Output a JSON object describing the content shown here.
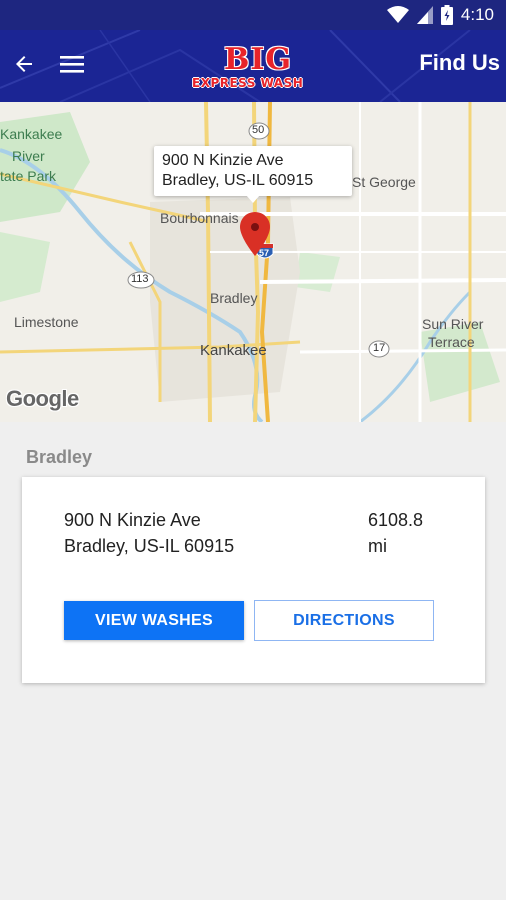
{
  "status_bar": {
    "time": "4:10",
    "icons": [
      "wifi-icon",
      "cell-signal-icon",
      "battery-icon"
    ]
  },
  "app_bar": {
    "title": "Find Us",
    "back_icon": "arrow-back-icon",
    "menu_icon": "hamburger-menu-icon",
    "logo": {
      "big": "BIG",
      "sub": "EXPRESS WASH"
    },
    "colors": {
      "background": "#1b2594",
      "status_bar": "#1e2680"
    }
  },
  "map": {
    "callout": {
      "line1": "900 N Kinzie Ave",
      "line2": "Bradley, US-IL  60915"
    },
    "labels": {
      "kankakee_river": "Kankakee",
      "river": "River",
      "state_park": "tate Park",
      "bourbonnais": "Bourbonnais",
      "st_george": "St George",
      "bradley": "Bradley",
      "limestone": "Limestone",
      "kankakee": "Kankakee",
      "sun_river": "Sun River",
      "terrace": "Terrace"
    },
    "shields": {
      "route_50": "50",
      "route_113": "113",
      "route_17": "17",
      "interstate_57": "57"
    },
    "attribution": "Google",
    "pin_icon": "map-pin-icon"
  },
  "section": {
    "title": "Bradley"
  },
  "location_card": {
    "address_line1": "900 N Kinzie Ave",
    "address_line2": "Bradley, US-IL  60915",
    "distance_value": "6108.8",
    "distance_unit": "mi",
    "view_washes_label": "VIEW WASHES",
    "directions_label": "DIRECTIONS",
    "colors": {
      "primary": "#0d73f5",
      "outline": "#8fb6f3"
    }
  }
}
